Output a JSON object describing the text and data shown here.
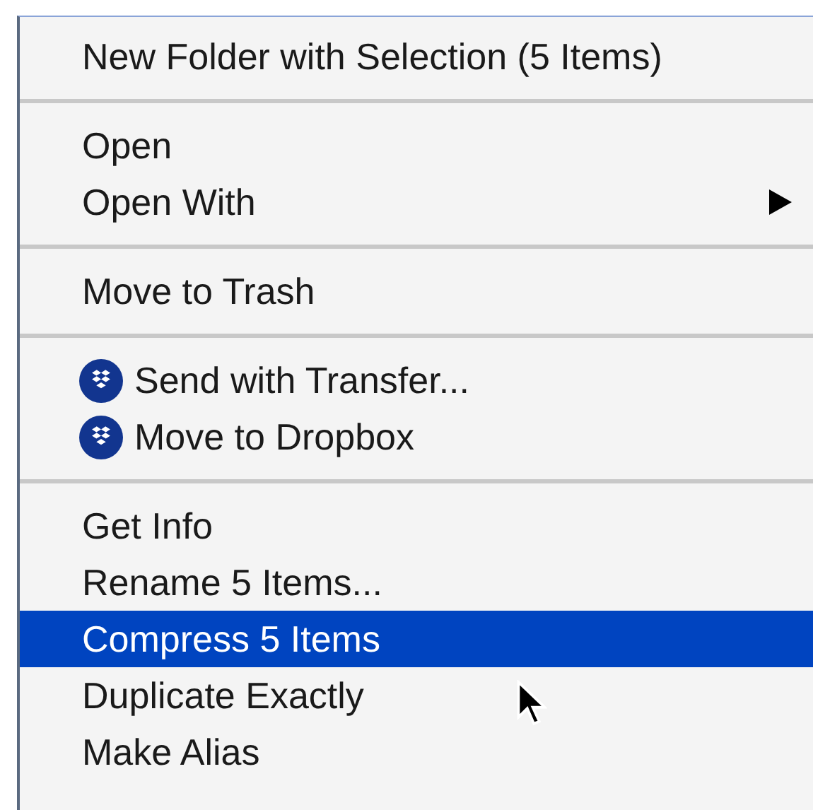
{
  "menu": {
    "groups": [
      {
        "items": [
          {
            "label": "New Folder with Selection (5 Items)",
            "kind": "plain",
            "selected": false
          }
        ]
      },
      {
        "items": [
          {
            "label": "Open",
            "kind": "plain",
            "selected": false
          },
          {
            "label": "Open With",
            "kind": "submenu",
            "selected": false
          }
        ]
      },
      {
        "items": [
          {
            "label": "Move to Trash",
            "kind": "plain",
            "selected": false
          }
        ]
      },
      {
        "items": [
          {
            "label": "Send with Transfer...",
            "kind": "icon",
            "selected": false
          },
          {
            "label": "Move to Dropbox",
            "kind": "icon",
            "selected": false
          }
        ]
      },
      {
        "items": [
          {
            "label": "Get Info",
            "kind": "plain",
            "selected": false
          },
          {
            "label": "Rename 5 Items...",
            "kind": "plain",
            "selected": false
          },
          {
            "label": "Compress 5 Items",
            "kind": "plain",
            "selected": true
          },
          {
            "label": "Duplicate Exactly",
            "kind": "plain",
            "selected": false
          },
          {
            "label": "Make Alias",
            "kind": "plain",
            "selected": false
          }
        ]
      }
    ]
  }
}
